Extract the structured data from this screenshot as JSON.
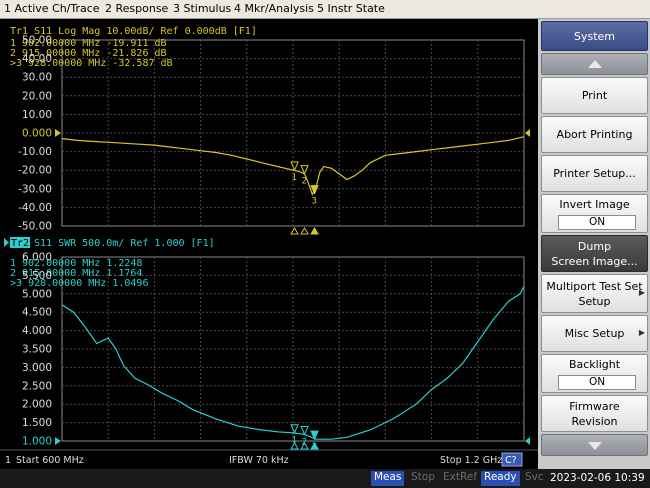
{
  "menubar": {
    "items": [
      "1 Active Ch/Trace",
      "2 Response",
      "3 Stimulus",
      "4 Mkr/Analysis",
      "5 Instr State"
    ]
  },
  "trace1": {
    "header": "Tr1 S11 Log Mag 10.00dB/ Ref 0.000dB [F1]",
    "color": "#d8c62a",
    "y_ticks": [
      "50.00",
      "40.00",
      "30.00",
      "20.00",
      "10.00",
      "0.000",
      "-10.00",
      "-20.00",
      "-30.00",
      "-40.00",
      "-50.00"
    ],
    "ref_value": 0,
    "markers": [
      {
        "id": "1",
        "prefix": " ",
        "freq": "902.00000 MHz",
        "value": "-19.911 dB",
        "x": 902,
        "y": -19.911
      },
      {
        "id": "2",
        "prefix": " ",
        "freq": "915.00000 MHz",
        "value": "-21.826 dB",
        "x": 915,
        "y": -21.826
      },
      {
        "id": "3",
        "prefix": ">",
        "freq": "928.00000 MHz",
        "value": "-32.587 dB",
        "x": 928,
        "y": -32.587
      }
    ]
  },
  "trace2": {
    "header_tag": "Tr2",
    "header": "S11 SWR 500.0m/ Ref 1.000 [F1]",
    "color": "#2ad0d0",
    "y_ticks": [
      "6.000",
      "5.500",
      "5.000",
      "4.500",
      "4.000",
      "3.500",
      "3.000",
      "2.500",
      "2.000",
      "1.500",
      "1.000"
    ],
    "ref_value": 1.0,
    "markers": [
      {
        "id": "1",
        "prefix": " ",
        "freq": "902.00000 MHz",
        "value": "1.2248",
        "x": 902,
        "y": 1.2248
      },
      {
        "id": "2",
        "prefix": " ",
        "freq": "915.00000 MHz",
        "value": "1.1764",
        "x": 915,
        "y": 1.1764
      },
      {
        "id": "3",
        "prefix": ">",
        "freq": "928.00000 MHz",
        "value": "1.0496",
        "x": 928,
        "y": 1.0496
      }
    ]
  },
  "chart_data": [
    {
      "type": "line",
      "title": "Tr1 S11 Log Mag 10.00dB/ Ref 0.000dB [F1]",
      "ylim": [
        -50,
        50
      ],
      "xlim": [
        600,
        1200
      ],
      "series": [
        {
          "name": "S11 Log Mag",
          "x": [
            600,
            620,
            640,
            660,
            680,
            700,
            720,
            740,
            760,
            780,
            800,
            820,
            840,
            860,
            880,
            890,
            900,
            905,
            910,
            915,
            920,
            925,
            930,
            935,
            940,
            950,
            960,
            970,
            980,
            990,
            1000,
            1020,
            1040,
            1060,
            1080,
            1100,
            1120,
            1140,
            1160,
            1180,
            1200
          ],
          "y": [
            -3,
            -4,
            -4.5,
            -5,
            -5.5,
            -6,
            -6.5,
            -7.5,
            -8.5,
            -9.5,
            -10.5,
            -12,
            -14,
            -16,
            -18,
            -19,
            -20,
            -20.5,
            -21,
            -22,
            -27,
            -33,
            -29,
            -21,
            -18,
            -19,
            -22,
            -25,
            -23,
            -20,
            -16,
            -12,
            -11,
            -10,
            -9,
            -8,
            -7,
            -6,
            -5,
            -4,
            -2
          ]
        }
      ]
    },
    {
      "type": "line",
      "title": "S11 SWR 500.0m/ Ref 1.000 [F1]",
      "ylim": [
        1.0,
        6.0
      ],
      "xlim": [
        600,
        1200
      ],
      "series": [
        {
          "name": "S11 SWR",
          "x": [
            600,
            615,
            630,
            645,
            660,
            670,
            680,
            695,
            710,
            730,
            750,
            770,
            800,
            830,
            860,
            880,
            900,
            915,
            930,
            950,
            970,
            1000,
            1030,
            1060,
            1080,
            1100,
            1120,
            1140,
            1160,
            1180,
            1195,
            1200
          ],
          "y": [
            4.7,
            4.5,
            4.1,
            3.65,
            3.8,
            3.5,
            3.05,
            2.7,
            2.55,
            2.3,
            2.1,
            1.85,
            1.6,
            1.4,
            1.3,
            1.25,
            1.22,
            1.18,
            1.05,
            1.05,
            1.1,
            1.3,
            1.6,
            2.0,
            2.4,
            2.7,
            3.1,
            3.7,
            4.3,
            4.8,
            5.0,
            5.2
          ]
        }
      ]
    }
  ],
  "footer": {
    "channel": "1",
    "start": "Start 600 MHz",
    "ifbw": "IFBW 70 kHz",
    "stop": "Stop 1.2 GHz",
    "badge": "C?"
  },
  "softkeys": {
    "title": "System",
    "print": "Print",
    "abort_printing": "Abort Printing",
    "printer_setup": "Printer Setup...",
    "invert_image": "Invert Image",
    "invert_image_value": "ON",
    "dump_line1": "Dump",
    "dump_line2": "Screen Image...",
    "multiport_line1": "Multiport Test Set",
    "multiport_line2": "Setup",
    "misc_setup": "Misc Setup",
    "backlight": "Backlight",
    "backlight_value": "ON",
    "firmware_line1": "Firmware",
    "firmware_line2": "Revision"
  },
  "statusbar": {
    "meas": "Meas",
    "stop": "Stop",
    "extref": "ExtRef",
    "ready": "Ready",
    "svc": "Svc",
    "datetime": "2023-02-06 10:39"
  }
}
